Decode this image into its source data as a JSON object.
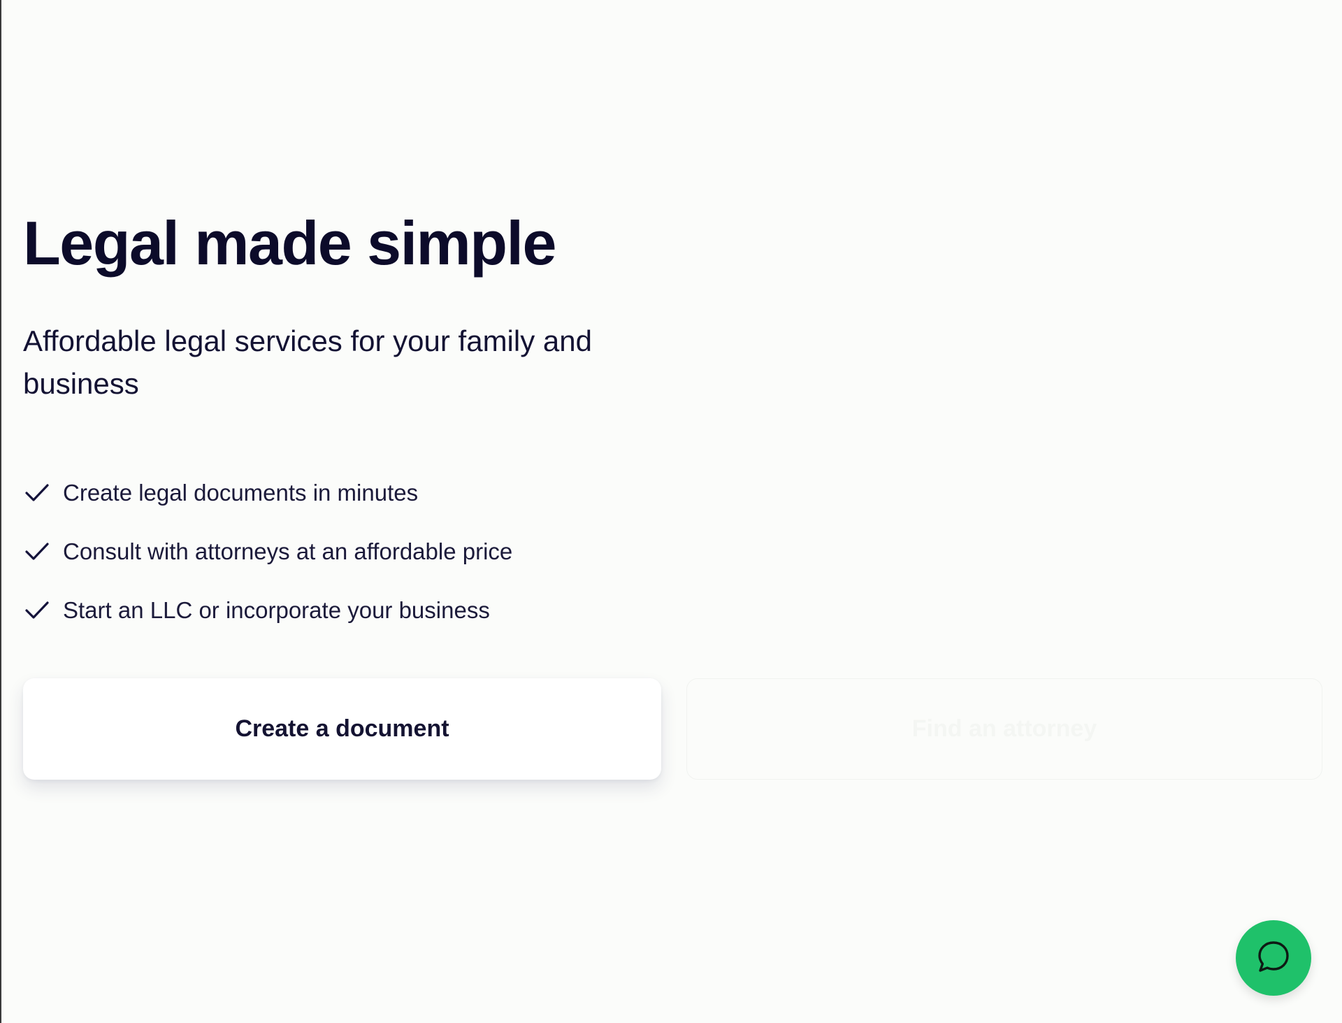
{
  "hero": {
    "title": "Legal made simple",
    "subtitle": "Affordable legal services for your family and business",
    "features": [
      {
        "icon": "check-icon",
        "text": "Create legal documents in minutes"
      },
      {
        "icon": "check-icon",
        "text": "Consult with attorneys at an affordable price"
      },
      {
        "icon": "check-icon",
        "text": "Start an LLC or incorporate your business"
      }
    ]
  },
  "cta": {
    "primary_label": "Create a document",
    "secondary_label": "Find an attorney"
  },
  "chat": {
    "icon": "chat-bubble-icon",
    "color": "#1fc16a"
  },
  "colors": {
    "background": "#fbfcfa",
    "heading": "#0c0b2a",
    "accent_green": "#1fc16a"
  }
}
